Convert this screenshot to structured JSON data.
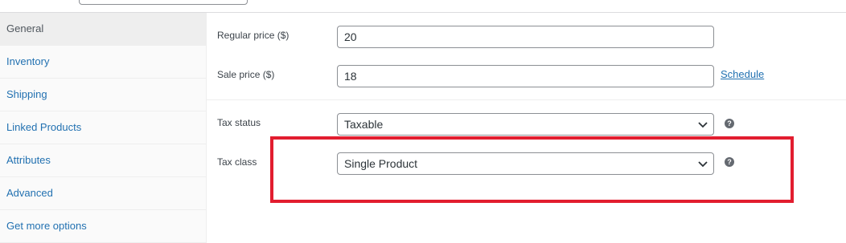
{
  "tabs": [
    {
      "label": "General",
      "active": true
    },
    {
      "label": "Inventory",
      "active": false
    },
    {
      "label": "Shipping",
      "active": false
    },
    {
      "label": "Linked Products",
      "active": false
    },
    {
      "label": "Attributes",
      "active": false
    },
    {
      "label": "Advanced",
      "active": false
    },
    {
      "label": "Get more options",
      "active": false
    }
  ],
  "pricing": {
    "regular_label": "Regular price ($)",
    "regular_value": "20",
    "sale_label": "Sale price ($)",
    "sale_value": "18",
    "schedule_link": "Schedule"
  },
  "tax": {
    "status_label": "Tax status",
    "status_value": "Taxable",
    "class_label": "Tax class",
    "class_value": "Single Product",
    "help_icon": "question-circle-icon"
  },
  "colors": {
    "link": "#2271b1",
    "highlight": "#e21d2f",
    "active_tab_bg": "#eeeeee"
  }
}
